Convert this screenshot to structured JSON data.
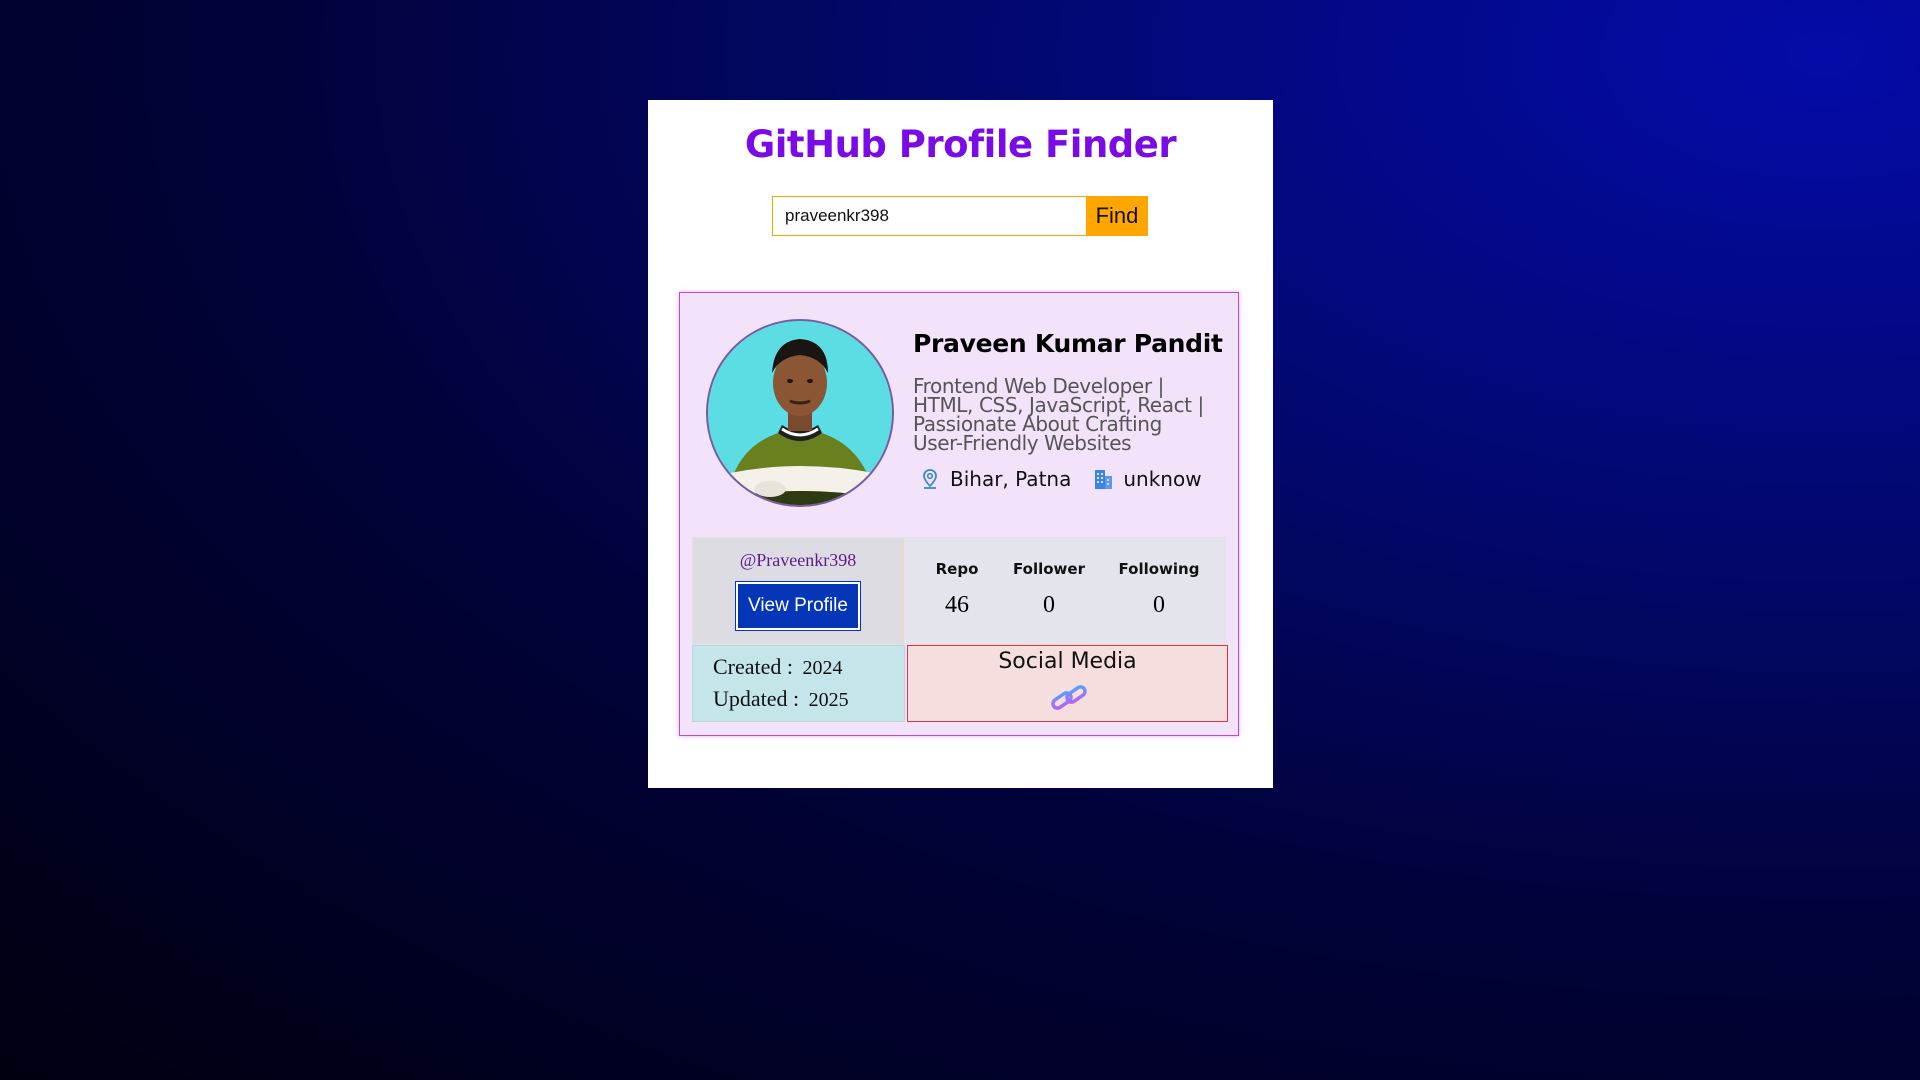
{
  "app": {
    "title": "GitHub Profile Finder"
  },
  "search": {
    "value": "praveenkr398",
    "button_label": "Find"
  },
  "profile": {
    "name": "Praveen Kumar Pandit",
    "bio": "Frontend Web Developer | HTML, CSS, JavaScript, React | Passionate About Crafting User-Friendly Websites",
    "location": "Bihar, Patna",
    "company": "unknow",
    "login": "@Praveenkr398",
    "view_profile_label": "View Profile",
    "avatar_icon": "user-photo"
  },
  "stats": {
    "repo_label": "Repo",
    "repo": "46",
    "follower_label": "Follower",
    "followers": "0",
    "following_label": "Following",
    "following": "0"
  },
  "dates": {
    "created_label": "Created :",
    "created": "2024",
    "updated_label": "Updated :",
    "updated": "2025"
  },
  "social": {
    "title": "Social Media",
    "icon": "link-icon"
  },
  "colors": {
    "title": "#7a0ae6",
    "find_button": "#ffa600",
    "view_button": "#0636b8",
    "card_bg": "#f2e3fb",
    "social_border": "#d9363e"
  }
}
